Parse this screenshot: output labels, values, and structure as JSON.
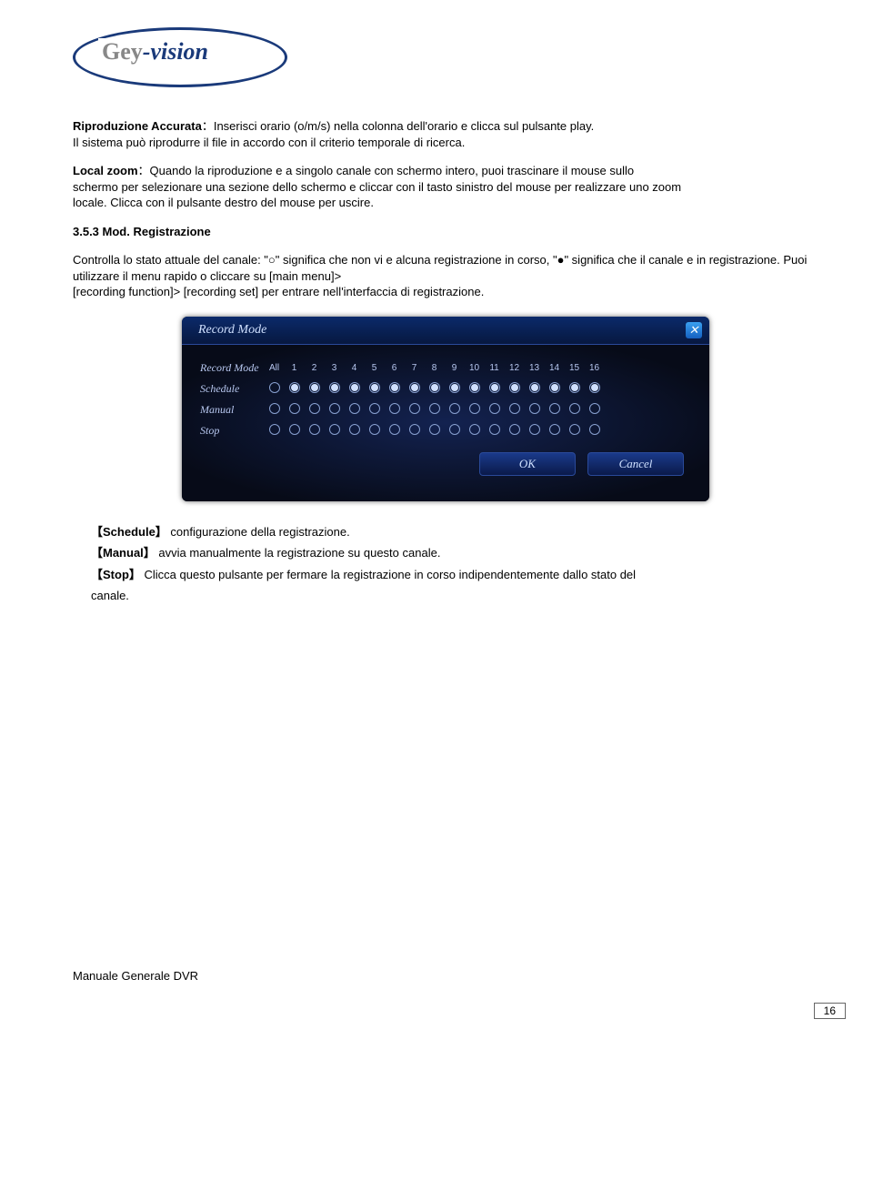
{
  "logo": {
    "text_grey": "Gey",
    "text_dash": "-",
    "text_blue": "vision"
  },
  "para1": {
    "label": "Riproduzione Accurata",
    "text": "：Inserisci orario (o/m/s) nella colonna dell'orario e clicca sul pulsante play.",
    "line2": " Il sistema può riprodurre il file in accordo con il criterio temporale di ricerca."
  },
  "para2": {
    "label": "Local zoom",
    "text": "：Quando la riproduzione e a singolo canale con schermo intero, puoi trascinare il mouse sullo",
    "line2": "schermo per selezionare una sezione dello schermo e cliccar con il tasto sinistro del mouse per realizzare uno zoom",
    "line3": "locale. Clicca con il pulsante destro del mouse per uscire."
  },
  "section": {
    "heading": "3.5.3 Mod. Registrazione",
    "text1": "Controlla lo stato attuale del canale: \"○\" significa che non vi e alcuna registrazione in corso, \"●\" significa che il canale e in registrazione. Puoi utilizzare il menu rapido o cliccare su [main menu]>",
    "text2": "[recording function]> [recording set] per entrare nell'interfaccia di registrazione."
  },
  "dialog": {
    "title": "Record Mode",
    "close": "✕",
    "row_header": "Record Mode",
    "col_all": "All",
    "cols": [
      "1",
      "2",
      "3",
      "4",
      "5",
      "6",
      "7",
      "8",
      "9",
      "10",
      "11",
      "12",
      "13",
      "14",
      "15",
      "16"
    ],
    "rows": [
      {
        "label": "Schedule",
        "all": false,
        "values": [
          true,
          true,
          true,
          true,
          true,
          true,
          true,
          true,
          true,
          true,
          true,
          true,
          true,
          true,
          true,
          true
        ]
      },
      {
        "label": "Manual",
        "all": false,
        "values": [
          false,
          false,
          false,
          false,
          false,
          false,
          false,
          false,
          false,
          false,
          false,
          false,
          false,
          false,
          false,
          false
        ]
      },
      {
        "label": "Stop",
        "all": false,
        "values": [
          false,
          false,
          false,
          false,
          false,
          false,
          false,
          false,
          false,
          false,
          false,
          false,
          false,
          false,
          false,
          false
        ]
      }
    ],
    "ok": "OK",
    "cancel": "Cancel"
  },
  "definitions": {
    "schedule": {
      "bracket": "【Schedule】",
      "text": "configurazione della registrazione."
    },
    "manual": {
      "bracket": "【Manual】",
      "text": "avvia manualmente la registrazione su questo canale."
    },
    "stop": {
      "bracket": "【Stop】",
      "text": "Clicca questo pulsante per fermare la registrazione in corso indipendentemente dallo stato del",
      "text2": "canale."
    }
  },
  "footer": {
    "text": "Manuale Generale DVR",
    "page": "16"
  }
}
